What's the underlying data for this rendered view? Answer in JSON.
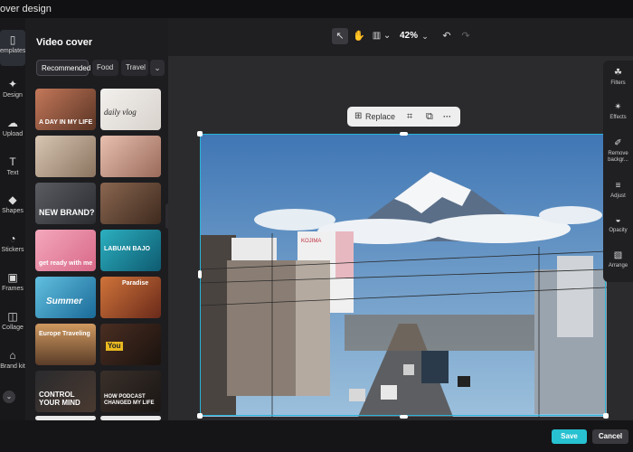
{
  "window": {
    "title": "over design"
  },
  "rail": {
    "items": [
      {
        "label": "emplates",
        "icon": "templates-icon",
        "glyph": "▯"
      },
      {
        "label": "Design",
        "icon": "design-icon",
        "glyph": "✦"
      },
      {
        "label": "Upload",
        "icon": "upload-icon",
        "glyph": "☁"
      },
      {
        "label": "Text",
        "icon": "text-icon",
        "glyph": "T"
      },
      {
        "label": "Shapes",
        "icon": "shapes-icon",
        "glyph": "◆"
      },
      {
        "label": "Stickers",
        "icon": "stickers-icon",
        "glyph": "◔"
      },
      {
        "label": "Frames",
        "icon": "frames-icon",
        "glyph": "▣"
      },
      {
        "label": "Collage",
        "icon": "collage-icon",
        "glyph": "◫"
      },
      {
        "label": "Brand kit",
        "icon": "brand-kit-icon",
        "glyph": "⌂"
      }
    ],
    "more_glyph": "⌄"
  },
  "panel": {
    "title": "Video cover",
    "filters": [
      "Recommended",
      "Food",
      "Travel"
    ],
    "more_glyph": "⌄",
    "templates": [
      {
        "text": "A DAY IN MY LIFE",
        "bg": "#7a4a32"
      },
      {
        "text": "daily vlog",
        "bg": "#e9e6e2"
      },
      {
        "text": "",
        "bg": "#b8a48e"
      },
      {
        "text": "",
        "bg": "#c99a8a"
      },
      {
        "text": "NEW BRAND?",
        "bg": "#3a3c42"
      },
      {
        "text": "",
        "bg": "#6e4e3a"
      },
      {
        "text": "get ready with me",
        "bg": "#e890a8"
      },
      {
        "text": "LABUAN BAJO",
        "bg": "#1d8aa0"
      },
      {
        "text": "Summer",
        "bg": "#3fa0c8"
      },
      {
        "text": "Paradise",
        "bg": "#8a3a24"
      },
      {
        "text": "Europe Traveling",
        "bg": "#b07848"
      },
      {
        "text": "You",
        "bg": "#2c1e18"
      },
      {
        "text": "CONTROL YOUR MIND",
        "bg": "#1e1e22"
      },
      {
        "text": "HOW PODCAST CHANGED MY LIFE",
        "bg": "#2a2522"
      }
    ]
  },
  "toolbar": {
    "select_glyph": "↖",
    "hand_glyph": "✋",
    "layout_glyph": "▥ ⌄",
    "zoom": "42%",
    "zoom_chevron": "⌄",
    "undo_glyph": "↶",
    "redo_glyph": "↷"
  },
  "float_toolbar": {
    "replace_label": "Replace",
    "replace_glyph": "⊞",
    "crop_glyph": "⌗",
    "copy_glyph": "⧉",
    "more_glyph": "···"
  },
  "right_panel": {
    "items": [
      {
        "label": "Filters",
        "icon": "filters-icon",
        "glyph": "☘"
      },
      {
        "label": "Effects",
        "icon": "effects-icon",
        "glyph": "✴"
      },
      {
        "label": "Remove backgr...",
        "icon": "remove-background-icon",
        "glyph": "✐"
      },
      {
        "label": "Adjust",
        "icon": "adjust-icon",
        "glyph": "≡"
      },
      {
        "label": "Opacity",
        "icon": "opacity-icon",
        "glyph": "◒"
      },
      {
        "label": "Arrange",
        "icon": "arrange-icon",
        "glyph": "▧"
      }
    ]
  },
  "canvas": {
    "sign_text": "KOJIMA"
  },
  "footer": {
    "save_label": "Save",
    "cancel_label": "Cancel"
  },
  "colors": {
    "accent": "#27c1d1",
    "selection": "#28b4d8"
  }
}
